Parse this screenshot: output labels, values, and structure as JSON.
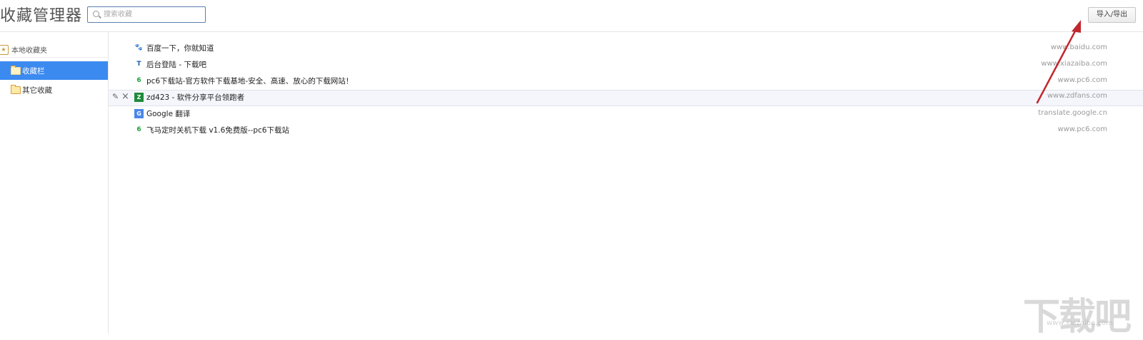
{
  "header": {
    "title": "收藏管理器",
    "search_placeholder": "搜索收藏",
    "import_export_label": "导入/导出"
  },
  "sidebar": {
    "root_label": "本地收藏夹",
    "items": [
      {
        "label": "收藏栏",
        "active": true
      },
      {
        "label": "其它收藏",
        "active": false
      }
    ]
  },
  "bookmarks": [
    {
      "title": "百度一下，你就知道",
      "url": "www.baidu.com",
      "icon": "baidu-paw-icon"
    },
    {
      "title": "后台登陆 - 下载吧",
      "url": "www.xiazaiba.com",
      "icon": "xiazaiba-icon"
    },
    {
      "title": "pc6下载站-官方软件下载基地-安全、高速、放心的下载网站！",
      "url": "www.pc6.com",
      "icon": "pc6-icon"
    },
    {
      "title": "zd423 - 软件分享平台领跑者",
      "url": "www.zdfans.com",
      "icon": "zd423-icon"
    },
    {
      "title": "Google 翻译",
      "url": "translate.google.cn",
      "icon": "google-translate-icon"
    },
    {
      "title": "飞马定时关机下载 v1.6免费版--pc6下载站",
      "url": "www.pc6.com",
      "icon": "pc6-icon"
    }
  ],
  "watermark": {
    "text": "下载吧",
    "sub": "www.xiazaiba.com"
  },
  "colors": {
    "accent": "#3b8af0",
    "arrow": "#c0282e"
  }
}
